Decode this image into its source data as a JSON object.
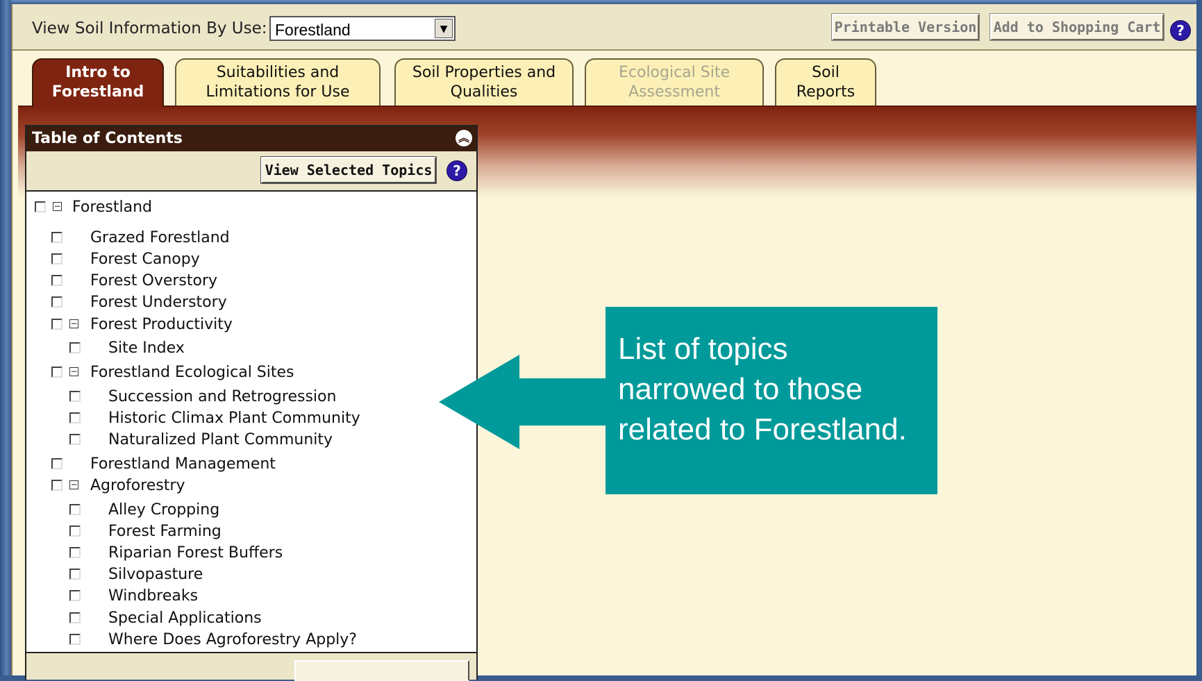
{
  "topbar": {
    "view_label": "View Soil Information By Use:",
    "use_select_value": "Forestland",
    "printable_label": "Printable Version",
    "cart_label": "Add to Shopping Cart",
    "help_glyph": "?"
  },
  "tabs": [
    {
      "label_line1": "Intro to",
      "label_line2": "Forestland",
      "state": "active"
    },
    {
      "label_line1": "Suitabilities and",
      "label_line2": "Limitations for Use",
      "state": "normal"
    },
    {
      "label_line1": "Soil Properties and",
      "label_line2": "Qualities",
      "state": "normal"
    },
    {
      "label_line1": "Ecological Site",
      "label_line2": "Assessment",
      "state": "disabled"
    },
    {
      "label_line1": "Soil",
      "label_line2": "Reports",
      "state": "normal"
    }
  ],
  "toc": {
    "title": "Table of Contents",
    "view_selected_label": "View Selected Topics",
    "items": [
      {
        "label": "Forestland",
        "level": 0,
        "expandable": true
      },
      {
        "label": "Grazed Forestland",
        "level": 1,
        "expandable": false
      },
      {
        "label": "Forest Canopy",
        "level": 1,
        "expandable": false
      },
      {
        "label": "Forest Overstory",
        "level": 1,
        "expandable": false
      },
      {
        "label": "Forest Understory",
        "level": 1,
        "expandable": false
      },
      {
        "label": "Forest Productivity",
        "level": 1,
        "expandable": true
      },
      {
        "label": "Site Index",
        "level": 2,
        "expandable": false
      },
      {
        "label": "Forestland Ecological Sites",
        "level": 1,
        "expandable": true
      },
      {
        "label": "Succession and Retrogression",
        "level": 2,
        "expandable": false
      },
      {
        "label": "Historic Climax Plant Community",
        "level": 2,
        "expandable": false
      },
      {
        "label": "Naturalized Plant Community",
        "level": 2,
        "expandable": false
      },
      {
        "label": "Forestland Management",
        "level": 1,
        "expandable": false
      },
      {
        "label": "Agroforestry",
        "level": 1,
        "expandable": true
      },
      {
        "label": "Alley Cropping",
        "level": 2,
        "expandable": false
      },
      {
        "label": "Forest Farming",
        "level": 2,
        "expandable": false
      },
      {
        "label": "Riparian Forest Buffers",
        "level": 2,
        "expandable": false
      },
      {
        "label": "Silvopasture",
        "level": 2,
        "expandable": false
      },
      {
        "label": "Windbreaks",
        "level": 2,
        "expandable": false
      },
      {
        "label": "Special Applications",
        "level": 2,
        "expandable": false
      },
      {
        "label": "Where Does Agroforestry Apply?",
        "level": 2,
        "expandable": false
      }
    ]
  },
  "callout": {
    "text_line1": "List of topics",
    "text_line2": "narrowed to those",
    "text_line3": "related to Forestland."
  },
  "colors": {
    "active_tab": "#7f2410",
    "callout": "#009a9a",
    "help_icon": "#2c1aa6",
    "panel_bg": "#fbf5d9"
  }
}
